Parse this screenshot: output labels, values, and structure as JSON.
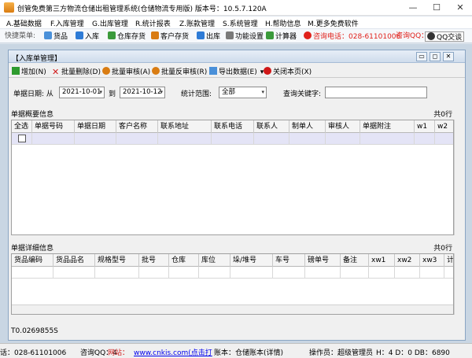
{
  "window": {
    "title": "创管免费第三方物流仓储出租管理系统(仓储物流专用版) 版本号：10.5.7.120A",
    "min": "—",
    "max": "☐",
    "close": "✕"
  },
  "menu": [
    "A.基础数据",
    "F.入库管理",
    "G.出库管理",
    "R.统计报表",
    "Z.账款管理",
    "S.系统管理",
    "H.帮助信息",
    "M.更多免费软件"
  ],
  "quick": {
    "label": "快捷菜单:",
    "items": [
      "货品",
      "入库",
      "仓库存货",
      "客户存货",
      "出库",
      "功能设置",
      "计算器"
    ],
    "phone_label": "咨询电话：",
    "phone": "028-61101006",
    "qq_label": "咨询QQ：",
    "qq_btn": "QQ交谈"
  },
  "child": {
    "title": "【入库单管理】",
    "min": "▭",
    "max": "◻",
    "close": "✕"
  },
  "toolbar": [
    "增加(N)",
    "批量删除(D)",
    "批量审核(A)",
    "批量反审核(R)",
    "导出数据(E)",
    "关闭本页(X)"
  ],
  "toolbar_dropdown_arrow": "▾",
  "filter": {
    "date_label": "单据日期: 从",
    "date_from": "2021-10-01",
    "date_to_label": "到",
    "date_to": "2021-10-12",
    "scope_label": "统计范围:",
    "scope": "全部",
    "keyword_label": "查询关键字:",
    "keyword": "",
    "arrow": "▾"
  },
  "summary": {
    "title": "单据概要信息",
    "count": "共0行",
    "columns": [
      "全选",
      "单据号码",
      "单据日期",
      "客户名称",
      "联系地址",
      "联系电话",
      "联系人",
      "制单人",
      "审核人",
      "单据附注",
      "w1",
      "w2"
    ]
  },
  "detail": {
    "title": "单据详细信息",
    "count": "共0行",
    "columns": [
      "货品编码",
      "货品品名",
      "规格型号",
      "批号",
      "仓库",
      "库位",
      "垛/堆号",
      "车号",
      "磅单号",
      "备注",
      "xw1",
      "xw2",
      "xw3",
      "计租方式"
    ]
  },
  "footer_text": "T0.0269855S",
  "status": {
    "phone": "话：028-61101006",
    "qq": "咨询QQ：4",
    "website_label": "网站：",
    "website": "www.cnkis.com(点击打",
    "account": "账本：仓储账本(详情)",
    "operator": "操作员：超级管理员",
    "hd": "H：4 D：0 DB：6890"
  },
  "colors": {
    "red": "#e0201a",
    "link": "#0000ee",
    "row_select": "#e4e4f6"
  }
}
